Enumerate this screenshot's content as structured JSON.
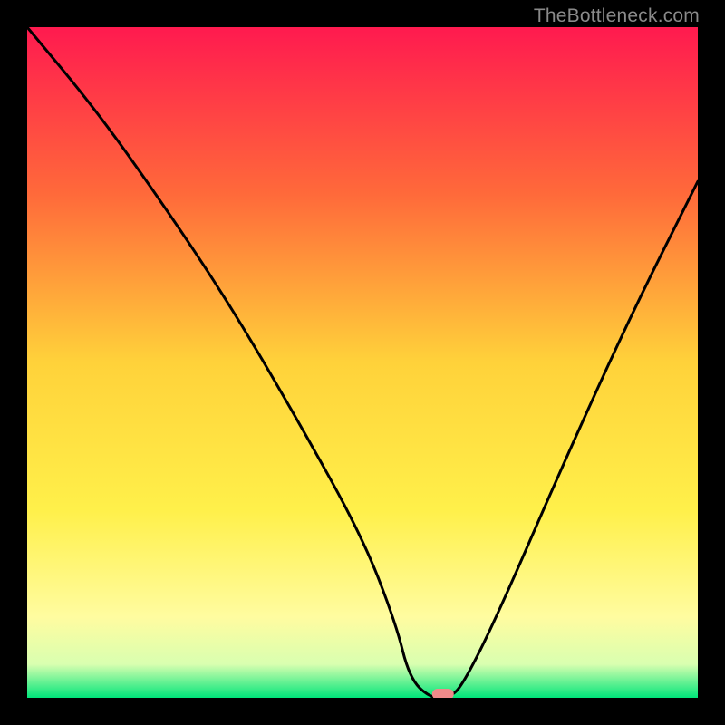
{
  "watermark": "TheBottleneck.com",
  "chart_data": {
    "type": "line",
    "title": "",
    "xlabel": "",
    "ylabel": "",
    "xlim": [
      0,
      100
    ],
    "ylim": [
      0,
      100
    ],
    "background": "vertical heatmap gradient, red (top/high) to green (bottom/low)",
    "series": [
      {
        "name": "bottleneck-curve",
        "x": [
          0,
          10,
          20,
          30,
          40,
          50,
          55,
          57,
          60,
          63,
          65,
          70,
          80,
          90,
          100
        ],
        "values": [
          100,
          88,
          74,
          59,
          42,
          24,
          11,
          3,
          0,
          0,
          2,
          12,
          35,
          57,
          77
        ]
      }
    ],
    "marker": {
      "name": "optimal-point",
      "x": 62,
      "y": 0,
      "color": "#f08a8a",
      "shape": "rounded-rect"
    },
    "green_band_y_top": 4,
    "gradient_stops": [
      {
        "pct": 0,
        "color": "#ff1a4f"
      },
      {
        "pct": 25,
        "color": "#ff6a3a"
      },
      {
        "pct": 50,
        "color": "#ffd23a"
      },
      {
        "pct": 72,
        "color": "#fff04a"
      },
      {
        "pct": 88,
        "color": "#fffca0"
      },
      {
        "pct": 95,
        "color": "#d9ffb0"
      },
      {
        "pct": 100,
        "color": "#00e57a"
      }
    ]
  }
}
